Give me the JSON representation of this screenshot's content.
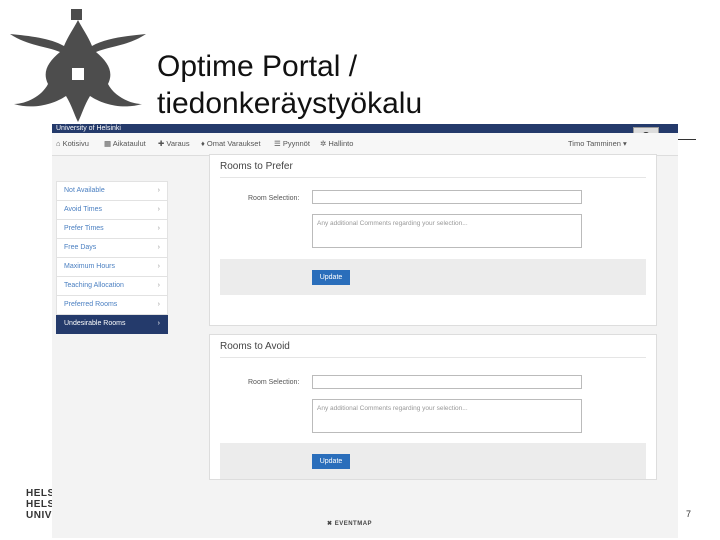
{
  "slide": {
    "title_line1": "Optime Portal /",
    "title_line2": "tiedonkeräystyökalu",
    "footer_lines": [
      "HELSI",
      "HELSI",
      "UNIVE"
    ],
    "page_number": "7"
  },
  "app": {
    "university": "University of Helsinki",
    "nav": [
      {
        "label": "Koti­sivu",
        "icon": "home-icon"
      },
      {
        "label": "Aikataulut",
        "icon": "grid-icon"
      },
      {
        "label": "Varaus",
        "icon": "plus-icon"
      },
      {
        "label": "Omat Varaukset",
        "icon": "pin-icon"
      },
      {
        "label": "Pyynnöt",
        "icon": "list-icon"
      },
      {
        "label": "Hallinto",
        "icon": "gear-icon"
      }
    ],
    "user": "Timo Tamminen",
    "sidebar": [
      "Not Available",
      "Avoid Times",
      "Prefer Times",
      "Free Days",
      "Maximum Hours",
      "Teaching Allocation",
      "Preferred Rooms",
      "Undesirable Rooms"
    ],
    "sidebar_active": 7,
    "panels": [
      {
        "title": "Rooms to Prefer",
        "field_label": "Room Selection:",
        "input_value": "",
        "comments_placeholder": "Any additional Comments regarding your selection...",
        "button": "Update"
      },
      {
        "title": "Rooms to Avoid",
        "field_label": "Room Selection:",
        "input_value": "",
        "comments_placeholder": "Any additional Comments regarding your selection...",
        "button": "Update"
      }
    ],
    "brand": "EVENTMAP"
  },
  "colors": {
    "header": "#243a6b",
    "link": "#4a7fc1",
    "button": "#2a6ebb"
  }
}
